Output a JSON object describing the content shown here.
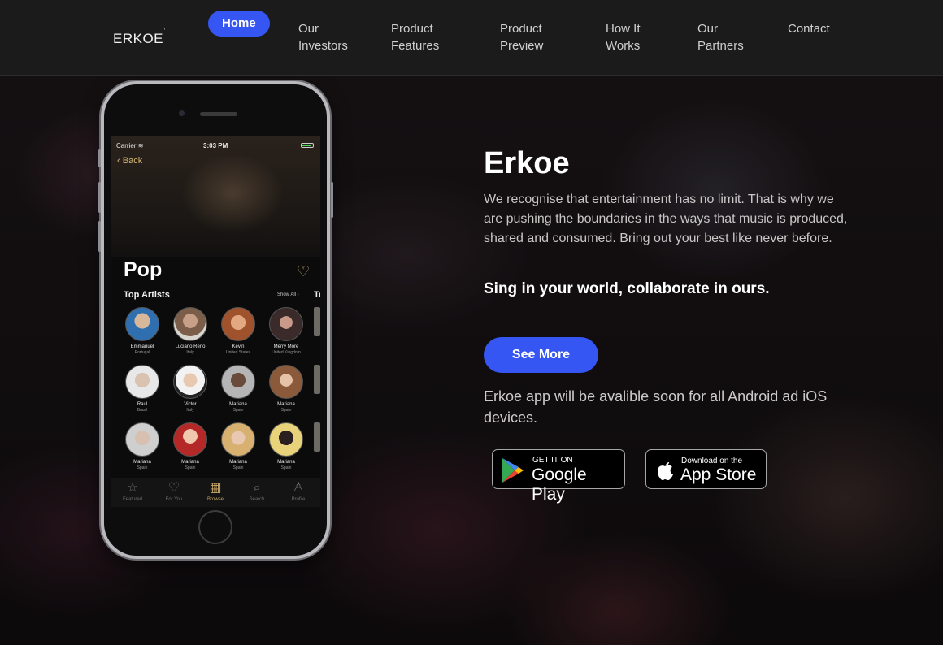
{
  "nav": {
    "logo": "ERKOE",
    "logo_mark": "'",
    "items": [
      {
        "label": "Home"
      },
      {
        "label": "Our\nInvestors"
      },
      {
        "label": "Product\nFeatures"
      },
      {
        "label": "Product\nPreview"
      },
      {
        "label": "How It\nWorks"
      },
      {
        "label": "Our\nPartners"
      },
      {
        "label": "Contact"
      }
    ],
    "accent_color": "#3556f2"
  },
  "phone": {
    "carrier": "Carrier",
    "time": "3:03 PM",
    "back_label": "Back",
    "title": "Pop",
    "section_title": "Top Artists",
    "show_all": "Show All",
    "next_section_clip": "To",
    "artists": [
      {
        "name": "Emmanuel",
        "country": "Portugal"
      },
      {
        "name": "Luciano Reno",
        "country": "Italy"
      },
      {
        "name": "Kevin",
        "country": "United States"
      },
      {
        "name": "Merry More",
        "country": "United Kingdom"
      },
      {
        "name": "Raul",
        "country": "Brasil"
      },
      {
        "name": "Victor",
        "country": "Italy"
      },
      {
        "name": "Mariana",
        "country": "Spain"
      },
      {
        "name": "Mariana",
        "country": "Spain"
      },
      {
        "name": "Mariana",
        "country": "Spain"
      },
      {
        "name": "Mariana",
        "country": "Spain"
      },
      {
        "name": "Mariana",
        "country": "Spain"
      },
      {
        "name": "Mariana",
        "country": "Spain"
      }
    ],
    "tabs": [
      {
        "label": "Featured",
        "icon": "star-icon"
      },
      {
        "label": "For You",
        "icon": "heart-icon"
      },
      {
        "label": "Browse",
        "icon": "grid-icon"
      },
      {
        "label": "Search",
        "icon": "search-icon"
      },
      {
        "label": "Profile",
        "icon": "user-icon"
      }
    ]
  },
  "hero": {
    "title": "Erkoe",
    "description": "We recognise that entertainment has no limit. That is why we are pushing the boundaries in the ways that music is produced, shared and consumed. Bring out your best like never before.",
    "tagline": "Sing in your world, collaborate in ours.",
    "cta_label": "See More",
    "availability": "Erkoe app will be avalible soon for all Android ad iOS devices."
  },
  "stores": {
    "google": {
      "small": "GET IT ON",
      "big": "Google Play"
    },
    "apple": {
      "small": "Download on the",
      "big": "App Store"
    }
  }
}
